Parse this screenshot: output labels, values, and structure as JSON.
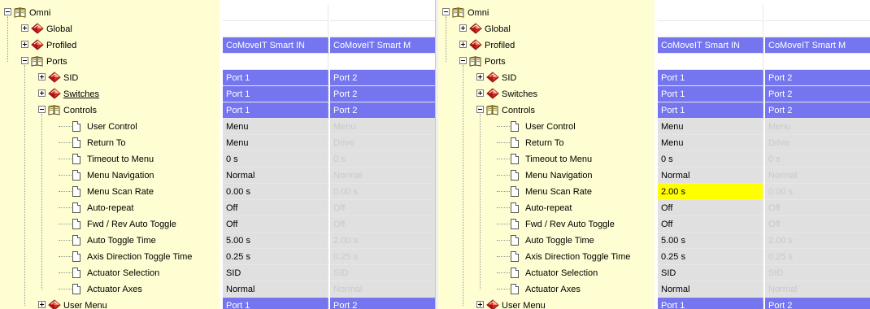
{
  "left": {
    "headers": [
      "CoMoveIT Smart IN",
      "CoMoveIT Smart M"
    ],
    "rows": [
      {
        "label": "Omni",
        "kind": "book",
        "exp": "minus",
        "level": 0,
        "c1": "",
        "c2": "",
        "style": "white"
      },
      {
        "label": "Global",
        "kind": "gem",
        "exp": "plus",
        "level": 1,
        "c1": "",
        "c2": "",
        "style": "white"
      },
      {
        "label": "Profiled",
        "kind": "gem",
        "exp": "plus",
        "level": 1,
        "c1": "CoMoveIT Smart IN",
        "c2": "CoMoveIT Smart M",
        "style": "blue"
      },
      {
        "label": "Ports",
        "kind": "book",
        "exp": "minus",
        "level": 1,
        "c1": "",
        "c2": "",
        "style": "white"
      },
      {
        "label": "SID",
        "kind": "gem",
        "exp": "plus",
        "level": 2,
        "c1": "Port 1",
        "c2": "Port 2",
        "style": "blue"
      },
      {
        "label": "Switches",
        "kind": "gem",
        "exp": "plus",
        "level": 2,
        "c1": "Port 1",
        "c2": "Port 2",
        "style": "blue",
        "underline": true
      },
      {
        "label": "Controls",
        "kind": "book",
        "exp": "minus",
        "level": 2,
        "c1": "Port 1",
        "c2": "Port 2",
        "style": "blue"
      },
      {
        "label": "User Control",
        "kind": "doc",
        "level": 3,
        "c1": "Menu",
        "c2": "Menu",
        "style": "grey"
      },
      {
        "label": "Return To",
        "kind": "doc",
        "level": 3,
        "c1": "Menu",
        "c2": "Drive",
        "style": "grey"
      },
      {
        "label": "Timeout to Menu",
        "kind": "doc",
        "level": 3,
        "c1": "0 s",
        "c2": "0 s",
        "style": "grey"
      },
      {
        "label": "Menu Navigation",
        "kind": "doc",
        "level": 3,
        "c1": "Normal",
        "c2": "Normal",
        "style": "grey"
      },
      {
        "label": "Menu Scan Rate",
        "kind": "doc",
        "level": 3,
        "c1": "0.00 s",
        "c2": "0.00 s",
        "style": "grey"
      },
      {
        "label": "Auto-repeat",
        "kind": "doc",
        "level": 3,
        "c1": "Off",
        "c2": "Off",
        "style": "grey"
      },
      {
        "label": "Fwd / Rev Auto Toggle",
        "kind": "doc",
        "level": 3,
        "c1": "Off",
        "c2": "Off",
        "style": "grey"
      },
      {
        "label": "Auto Toggle Time",
        "kind": "doc",
        "level": 3,
        "c1": "5.00 s",
        "c2": "2.00 s",
        "style": "grey"
      },
      {
        "label": "Axis Direction Toggle Time",
        "kind": "doc",
        "level": 3,
        "c1": "0.25 s",
        "c2": "0.25 s",
        "style": "grey"
      },
      {
        "label": "Actuator Selection",
        "kind": "doc",
        "level": 3,
        "c1": "SID",
        "c2": "SID",
        "style": "grey"
      },
      {
        "label": "Actuator Axes",
        "kind": "doc",
        "level": 3,
        "c1": "Normal",
        "c2": "Normal",
        "style": "grey"
      },
      {
        "label": "User Menu",
        "kind": "gem",
        "exp": "plus",
        "level": 2,
        "c1": "Port 1",
        "c2": "Port 2",
        "style": "blue"
      }
    ]
  },
  "right": {
    "headers": [
      "CoMoveIT Smart IN",
      "CoMoveIT Smart M"
    ],
    "rows": [
      {
        "label": "Omni",
        "kind": "book",
        "exp": "minus",
        "level": 0,
        "c1": "",
        "c2": "",
        "style": "white"
      },
      {
        "label": "Global",
        "kind": "gem",
        "exp": "plus",
        "level": 1,
        "c1": "",
        "c2": "",
        "style": "white"
      },
      {
        "label": "Profiled",
        "kind": "gem",
        "exp": "plus",
        "level": 1,
        "c1": "CoMoveIT Smart IN",
        "c2": "CoMoveIT Smart M",
        "style": "blue"
      },
      {
        "label": "Ports",
        "kind": "book",
        "exp": "minus",
        "level": 1,
        "c1": "",
        "c2": "",
        "style": "white"
      },
      {
        "label": "SID",
        "kind": "gem",
        "exp": "plus",
        "level": 2,
        "c1": "Port 1",
        "c2": "Port 2",
        "style": "blue"
      },
      {
        "label": "Switches",
        "kind": "gem",
        "exp": "plus",
        "level": 2,
        "c1": "Port 1",
        "c2": "Port 2",
        "style": "blue"
      },
      {
        "label": "Controls",
        "kind": "book",
        "exp": "minus",
        "level": 2,
        "c1": "Port 1",
        "c2": "Port 2",
        "style": "blue"
      },
      {
        "label": "User Control",
        "kind": "doc",
        "level": 3,
        "c1": "Menu",
        "c2": "Menu",
        "style": "grey"
      },
      {
        "label": "Return To",
        "kind": "doc",
        "level": 3,
        "c1": "Menu",
        "c2": "Drive",
        "style": "grey"
      },
      {
        "label": "Timeout to Menu",
        "kind": "doc",
        "level": 3,
        "c1": "0 s",
        "c2": "0 s",
        "style": "grey"
      },
      {
        "label": "Menu Navigation",
        "kind": "doc",
        "level": 3,
        "c1": "Normal",
        "c2": "Normal",
        "style": "grey"
      },
      {
        "label": "Menu Scan Rate",
        "kind": "doc",
        "level": 3,
        "c1": "2.00 s",
        "c2": "0.00 s",
        "style": "grey",
        "highlight": true
      },
      {
        "label": "Auto-repeat",
        "kind": "doc",
        "level": 3,
        "c1": "Off",
        "c2": "Off",
        "style": "grey"
      },
      {
        "label": "Fwd / Rev Auto Toggle",
        "kind": "doc",
        "level": 3,
        "c1": "Off",
        "c2": "Off",
        "style": "grey"
      },
      {
        "label": "Auto Toggle Time",
        "kind": "doc",
        "level": 3,
        "c1": "5.00 s",
        "c2": "2.00 s",
        "style": "grey"
      },
      {
        "label": "Axis Direction Toggle Time",
        "kind": "doc",
        "level": 3,
        "c1": "0.25 s",
        "c2": "0.25 s",
        "style": "grey"
      },
      {
        "label": "Actuator Selection",
        "kind": "doc",
        "level": 3,
        "c1": "SID",
        "c2": "SID",
        "style": "grey"
      },
      {
        "label": "Actuator Axes",
        "kind": "doc",
        "level": 3,
        "c1": "Normal",
        "c2": "Normal",
        "style": "grey"
      },
      {
        "label": "User Menu",
        "kind": "gem",
        "exp": "plus",
        "level": 2,
        "c1": "Port 1",
        "c2": "Port 2",
        "style": "blue"
      }
    ]
  },
  "colors": {
    "tree_bg": "#fefed2",
    "selected_blue": "#7575ef",
    "value_grey": "#e0e0e0",
    "changed_yellow": "#ffff00"
  },
  "icons": {
    "book": "open-book-icon",
    "gem": "red-diamond-icon",
    "doc": "document-icon",
    "expand": "plus-box-icon",
    "collapse": "minus-box-icon"
  }
}
